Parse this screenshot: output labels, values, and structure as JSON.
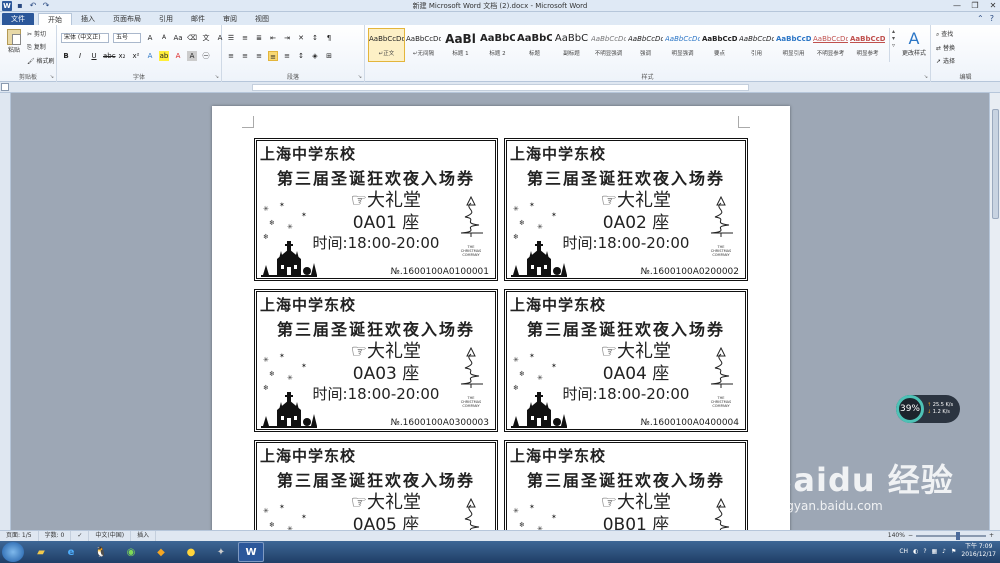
{
  "window": {
    "title": "新建 Microsoft Word 文档 (2).docx - Microsoft Word",
    "controls": [
      "—",
      "❐",
      "✕"
    ]
  },
  "tabs": [
    {
      "label": "文件",
      "kind": "file"
    },
    {
      "label": "开始",
      "kind": "active"
    },
    {
      "label": "插入",
      "kind": ""
    },
    {
      "label": "页面布局",
      "kind": ""
    },
    {
      "label": "引用",
      "kind": ""
    },
    {
      "label": "邮件",
      "kind": ""
    },
    {
      "label": "审阅",
      "kind": ""
    },
    {
      "label": "视图",
      "kind": ""
    }
  ],
  "ribbon": {
    "clipboard": {
      "paste": "粘贴",
      "cut": "剪切",
      "copy": "复制",
      "format_painter": "格式刷",
      "label": "剪贴板"
    },
    "font": {
      "face": "宋体 (中文正)",
      "size": "五号",
      "label": "字体"
    },
    "paragraph": {
      "label": "段落"
    },
    "styles": {
      "items": [
        {
          "sample": "AaBbCcDd",
          "name": "↵正文"
        },
        {
          "sample": "AaBbCcDd",
          "name": "↵无间隔"
        },
        {
          "sample": "AaBl",
          "name": "标题 1"
        },
        {
          "sample": "AaBbC",
          "name": "标题 2"
        },
        {
          "sample": "AaBbC",
          "name": "标题"
        },
        {
          "sample": "AaBbC",
          "name": "副标题"
        },
        {
          "sample": "AaBbCcDd",
          "name": "不明显强调"
        },
        {
          "sample": "AaBbCcDd",
          "name": "强调"
        },
        {
          "sample": "AaBbCcDd",
          "name": "明显强调"
        },
        {
          "sample": "AaBbCcDd",
          "name": "要点"
        },
        {
          "sample": "AaBbCcDd",
          "name": "引用"
        },
        {
          "sample": "AaBbCcDd",
          "name": "明显引用"
        },
        {
          "sample": "AaBbCcDd",
          "name": "不明显参考"
        },
        {
          "sample": "AaBbCcDd",
          "name": "明显参考"
        }
      ],
      "change_styles": "更改样式",
      "label": "样式"
    },
    "editing": {
      "find": "查找",
      "replace": "替换",
      "select": "选择",
      "label": "编辑"
    }
  },
  "tickets": [
    {
      "school": "上海中学东校",
      "event": "第三届圣诞狂欢夜入场券",
      "venue": "☞大礼堂",
      "seat": "0A01 座",
      "time": "时间:18:00-20:00",
      "number": "№.1600100A0100001"
    },
    {
      "school": "上海中学东校",
      "event": "第三届圣诞狂欢夜入场券",
      "venue": "☞大礼堂",
      "seat": "0A02 座",
      "time": "时间:18:00-20:00",
      "number": "№.1600100A0200002"
    },
    {
      "school": "上海中学东校",
      "event": "第三届圣诞狂欢夜入场券",
      "venue": "☞大礼堂",
      "seat": "0A03 座",
      "time": "时间:18:00-20:00",
      "number": "№.1600100A0300003"
    },
    {
      "school": "上海中学东校",
      "event": "第三届圣诞狂欢夜入场券",
      "venue": "☞大礼堂",
      "seat": "0A04 座",
      "time": "时间:18:00-20:00",
      "number": "№.1600100A0400004"
    },
    {
      "school": "上海中学东校",
      "event": "第三届圣诞狂欢夜入场券",
      "venue": "☞大礼堂",
      "seat": "0A05 座",
      "time": "",
      "number": ""
    },
    {
      "school": "上海中学东校",
      "event": "第三届圣诞狂欢夜入场券",
      "venue": "☞大礼堂",
      "seat": "0B01 座",
      "time": "",
      "number": ""
    }
  ],
  "tree_caption": {
    "line1": "THE",
    "line2": "CHRISTMAS",
    "line3": "COMPANY"
  },
  "statusbar": {
    "page": "页面: 1/5",
    "words": "字数: 0",
    "language": "中文(中国)",
    "mode": "插入",
    "zoom": "140%"
  },
  "network": {
    "percent": "39%",
    "up": "25.5 K/s",
    "down": "1.2 K/s"
  },
  "taskbar": {
    "time": "下午 7:09",
    "date": "2016/12/17",
    "ime": "CH",
    "active_app": "W"
  },
  "watermark": {
    "logo": "Baidu 经验",
    "url": "jingyan.baidu.com"
  },
  "colors": {
    "accent": "#2b579a",
    "taskbar": "#1f3e66",
    "selection": "#e3b53b"
  }
}
